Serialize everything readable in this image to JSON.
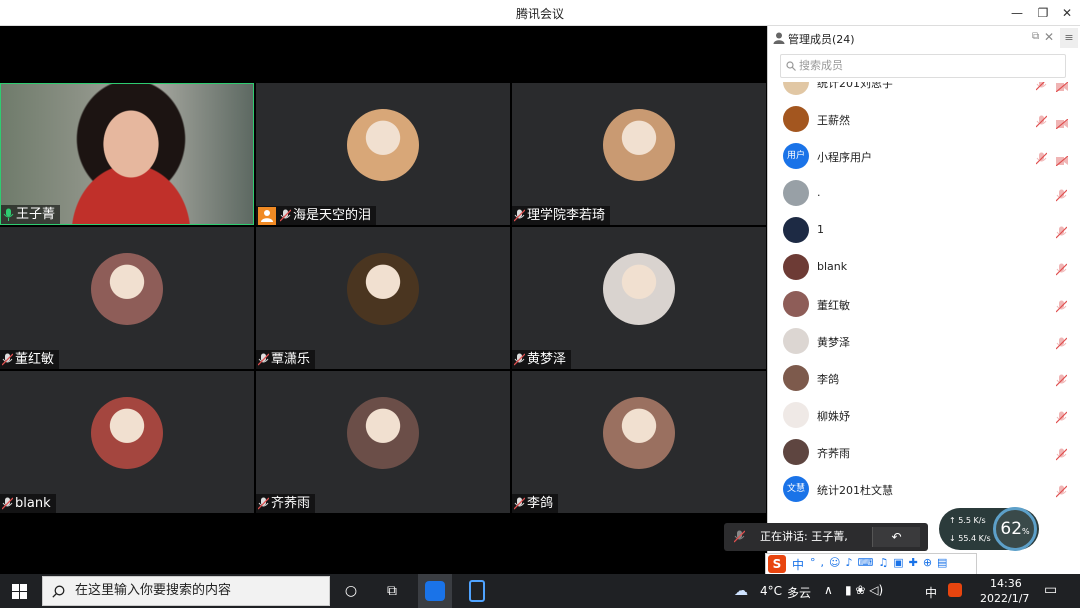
{
  "window": {
    "title": "腾讯会议"
  },
  "tiles": [
    {
      "name": "王子菁",
      "mic": "on",
      "host": false,
      "video": true,
      "avatar_color": ""
    },
    {
      "name": "海是天空的泪",
      "mic": "off",
      "host": true,
      "video": false,
      "avatar_color": "#d8a778"
    },
    {
      "name": "理学院李若琦",
      "mic": "off",
      "host": false,
      "video": false,
      "avatar_color": "#c99a72"
    },
    {
      "name": "董红敏",
      "mic": "off",
      "host": false,
      "video": false,
      "avatar_color": "#8e5d58"
    },
    {
      "name": "覃潇乐",
      "mic": "off",
      "host": false,
      "video": false,
      "avatar_color": "#4a3520"
    },
    {
      "name": "黄梦泽",
      "mic": "off",
      "host": false,
      "video": false,
      "avatar_color": "#d9d3cf"
    },
    {
      "name": "blank",
      "mic": "off",
      "host": false,
      "video": false,
      "avatar_color": "#a4463f"
    },
    {
      "name": "齐荞雨",
      "mic": "off",
      "host": false,
      "video": false,
      "avatar_color": "#6b4e48"
    },
    {
      "name": "李鸽",
      "mic": "off",
      "host": false,
      "video": false,
      "avatar_color": "#9a7060"
    }
  ],
  "panel": {
    "title": "管理成员(24)",
    "search_placeholder": "搜索成员",
    "members": [
      {
        "name": "统计201刘思宇",
        "avatar_text": "",
        "avatar_color": "#e1c7a4",
        "video_icon": true
      },
      {
        "name": "王薪然",
        "avatar_text": "",
        "avatar_color": "#a3561f",
        "video_icon": true
      },
      {
        "name": "小程序用户",
        "avatar_text": "用户",
        "avatar_color": "#1a73e8",
        "video_icon": true
      },
      {
        "name": ".",
        "avatar_text": "",
        "avatar_color": "#98a0a6",
        "video_icon": false
      },
      {
        "name": "1",
        "avatar_text": "",
        "avatar_color": "#1d2a44",
        "video_icon": false
      },
      {
        "name": "blank",
        "avatar_text": "",
        "avatar_color": "#6d3b35",
        "video_icon": false
      },
      {
        "name": "董红敏",
        "avatar_text": "",
        "avatar_color": "#8e5d58",
        "video_icon": false
      },
      {
        "name": "黄梦泽",
        "avatar_text": "",
        "avatar_color": "#dcd6d2",
        "video_icon": false
      },
      {
        "name": "李鸽",
        "avatar_text": "",
        "avatar_color": "#7d5a4c",
        "video_icon": false
      },
      {
        "name": "柳姝妤",
        "avatar_text": "",
        "avatar_color": "#efe9e6",
        "video_icon": false
      },
      {
        "name": "齐荞雨",
        "avatar_text": "",
        "avatar_color": "#5e4540",
        "video_icon": false
      },
      {
        "name": "统计201杜文慧",
        "avatar_text": "文慧",
        "avatar_color": "#1a73e8",
        "video_icon": false
      }
    ]
  },
  "speaking": {
    "text": "正在讲话: 王子菁,"
  },
  "network": {
    "up": "5.5",
    "down": "55.4",
    "unit": "K/s",
    "percent": "62",
    "percent_unit": "%"
  },
  "taskbar": {
    "search_placeholder": "在这里输入你要搜索的内容",
    "weather_temp": "4°C",
    "weather_text": "多云",
    "ime": "中",
    "time": "14:36",
    "date": "2022/1/7"
  },
  "colors": {
    "active_border": "#2ecc71",
    "accent": "#1a73e8",
    "muted_red": "#e05050"
  }
}
